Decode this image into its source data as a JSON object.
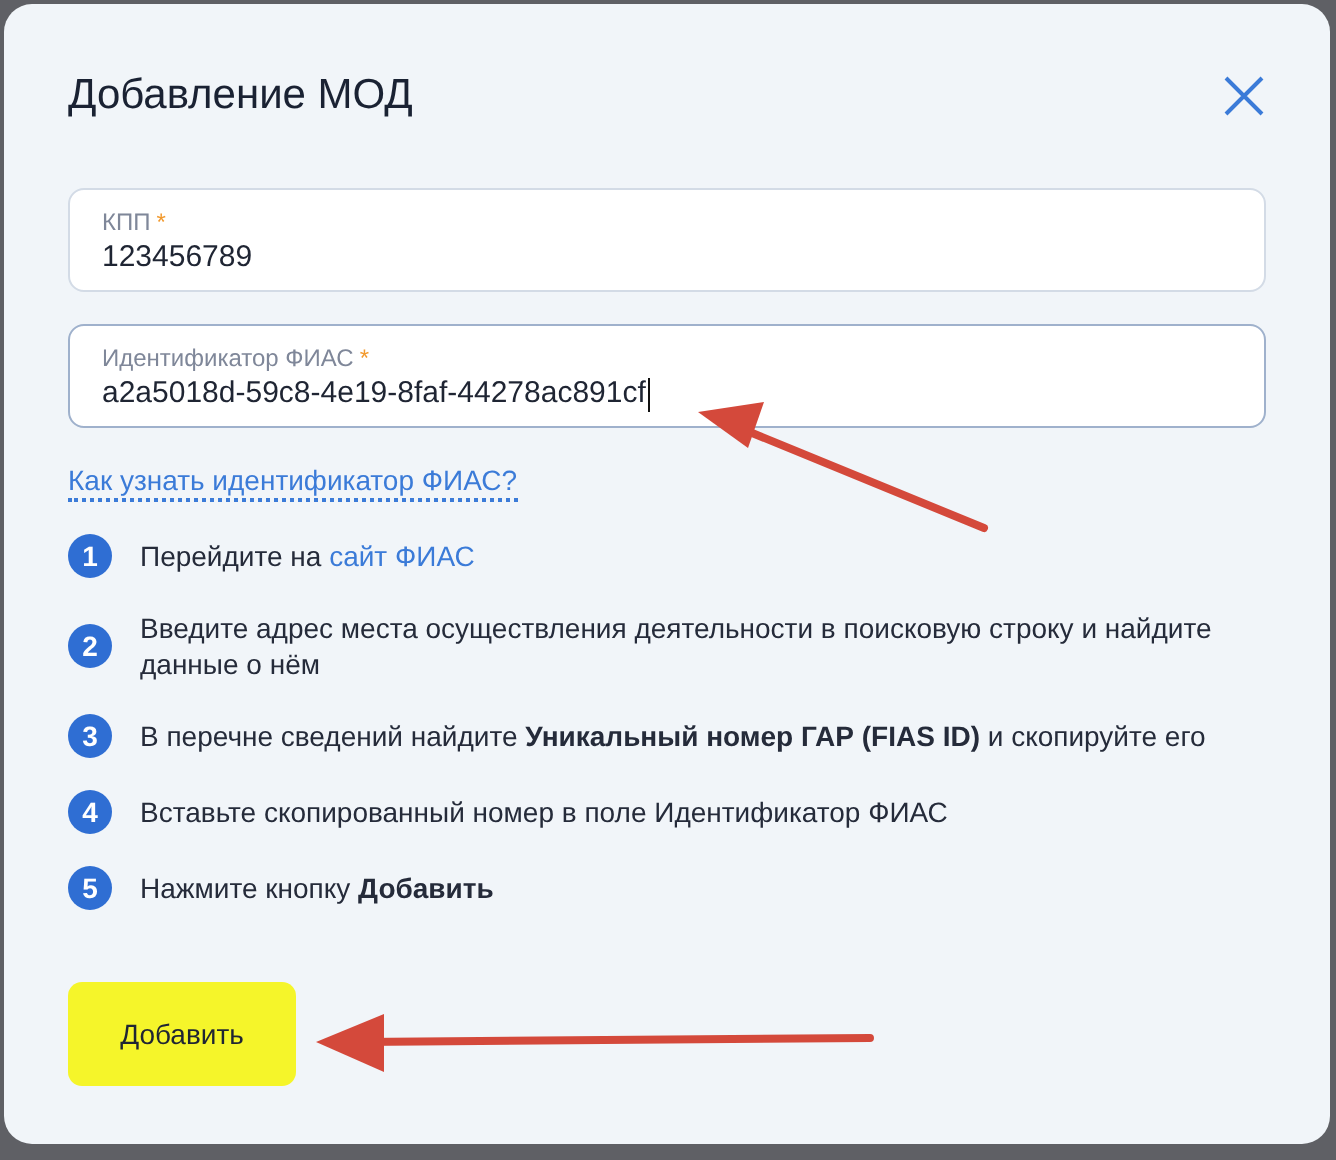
{
  "dialog": {
    "title": "Добавление МОД"
  },
  "fields": [
    {
      "label": "КПП",
      "required_mark": "*",
      "value": "123456789",
      "focused": false
    },
    {
      "label": "Идентификатор ФИАС",
      "required_mark": "*",
      "value": "a2a5018d-59c8-4e19-8faf-44278ac891cf",
      "focused": true
    }
  ],
  "help_link": "Как узнать идентификатор ФИАС?",
  "steps": [
    {
      "number": "1",
      "text": "Перейдите на",
      "link": "сайт ФИАС"
    },
    {
      "number": "2",
      "text": "Введите адрес места осуществления деятельности в поисковую строку и найдите данные о нём"
    },
    {
      "number": "3",
      "text": "В перечне сведений найдите **Уникальный номер ГАР (FIAS ID)** и скопируйте его"
    },
    {
      "number": "4",
      "text": "Вставьте скопированный номер в поле Идентификатор ФИАС"
    },
    {
      "number": "5",
      "text": "Нажмите кнопку **Добавить**"
    }
  ],
  "submit_button": "Добавить"
}
